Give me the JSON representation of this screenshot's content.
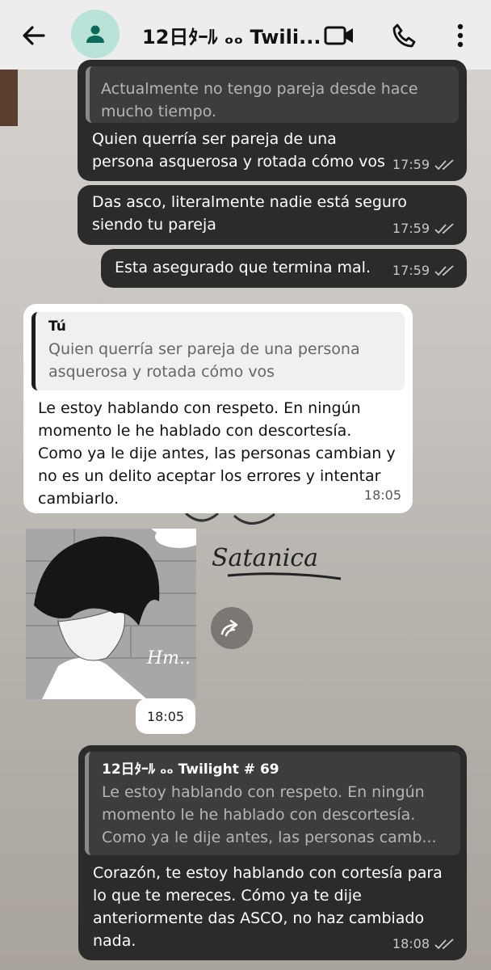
{
  "header": {
    "contact_name": "12日ﾀｰﾙ ₒₒ Twili...",
    "icons": [
      "back-arrow-icon",
      "person-icon",
      "video-call-icon",
      "phone-icon",
      "more-icon"
    ]
  },
  "messages": {
    "m1": {
      "quote_text": "Actualmente no tengo pareja desde hace mucho tiempo.",
      "text": "Quien querría ser pareja de una persona asquerosa y rotada cómo vos",
      "time": "17:59"
    },
    "m2": {
      "text": "Das asco, literalmente nadie está seguro siendo tu pareja",
      "time": "17:59"
    },
    "m3": {
      "text": "Esta asegurado que termina mal.",
      "time": "17:59"
    },
    "m4": {
      "quote_author": "Tú",
      "quote_text": "Quien querría ser pareja de una persona asquerosa y rotada cómo vos",
      "text": "Le estoy hablando con respeto. En ningún momento le he hablado con descortesía. Como ya le dije antes, las personas cambian y no es un delito aceptar los errores y intentar cambiarlo.",
      "time": "18:05"
    },
    "m5": {
      "image_caption": "Hm..",
      "time": "18:05"
    },
    "m6": {
      "quote_author": "12日ﾀｰﾙ ₒₒ Twilight   # 69",
      "quote_text": "Le estoy hablando con respeto. En ningún momento le he hablado con descortesía. Como ya le dije antes, las personas camb...",
      "text": "Corazón, te estoy hablando con cortesía para lo que te mereces. Cómo ya te dije anteriormente das ASCO, no haz cambiado nada.",
      "time": "18:08"
    }
  },
  "background_text": "Satanica",
  "colors": {
    "header_bg": "#ededed",
    "bubble_out": "#2b2b2b",
    "bubble_in": "#ffffff",
    "avatar_bg": "#b9e3d8",
    "avatar_fg": "#0b6b58"
  }
}
